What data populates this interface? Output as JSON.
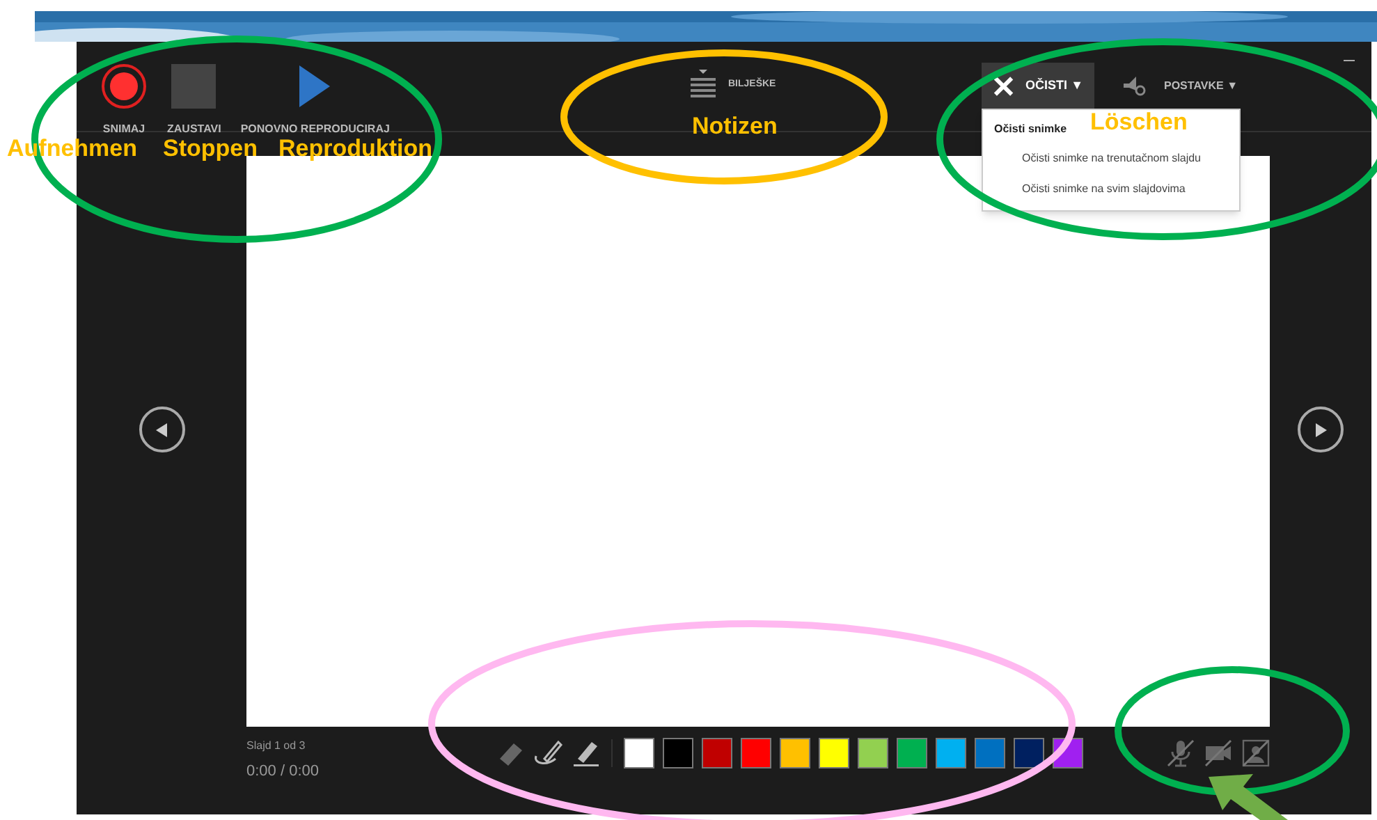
{
  "top_tools": [
    {
      "label": "SNIMAJ",
      "kind": "record"
    },
    {
      "label": "ZAUSTAVI",
      "kind": "stop"
    },
    {
      "label": "PONOVNO REPRODUCIRAJ",
      "kind": "replay"
    }
  ],
  "notes_button": {
    "label": "BILJEŠKE"
  },
  "clear_button": {
    "label": "OČISTI",
    "caret": "▼",
    "expanded": true
  },
  "settings_button": {
    "label": "POSTAVKE",
    "caret": "▼"
  },
  "clear_menu": {
    "header": "Očisti snimke",
    "items": [
      "Očisti snimke na trenutačnom slajdu",
      "Očisti snimke na svim slajdovima"
    ]
  },
  "status": {
    "slide_counter": "Slajd 1 od 3",
    "time": "0:00 / 0:00"
  },
  "pen_tools": [
    {
      "kind": "eraser"
    },
    {
      "kind": "pen"
    },
    {
      "kind": "highlighter"
    }
  ],
  "ink_colors": [
    {
      "color": "#ffffff"
    },
    {
      "color": "#000000"
    },
    {
      "color": "#c00000"
    },
    {
      "color": "#ff0000"
    },
    {
      "color": "#ffc000"
    },
    {
      "color": "#ffff00"
    },
    {
      "color": "#92d050"
    },
    {
      "color": "#00b050"
    },
    {
      "color": "#00b0f0"
    },
    {
      "color": "#0070c0"
    },
    {
      "color": "#002060"
    },
    {
      "color": "#a020f0"
    }
  ],
  "media_toggles": [
    {
      "kind": "microphone",
      "on": false
    },
    {
      "kind": "camera",
      "on": false
    },
    {
      "kind": "preview",
      "on": false
    }
  ],
  "annotations": {
    "labels": [
      {
        "text": "Aufnehmen"
      },
      {
        "text": "Stoppen"
      },
      {
        "text": "Reproduktion"
      },
      {
        "text": "Notizen"
      },
      {
        "text": "Löschen"
      }
    ],
    "ellipses": [
      {
        "color": "#00b050"
      },
      {
        "color": "#ffc000"
      },
      {
        "color": "#00b050"
      },
      {
        "color": "#ffb8f0"
      },
      {
        "color": "#00b050"
      }
    ]
  }
}
